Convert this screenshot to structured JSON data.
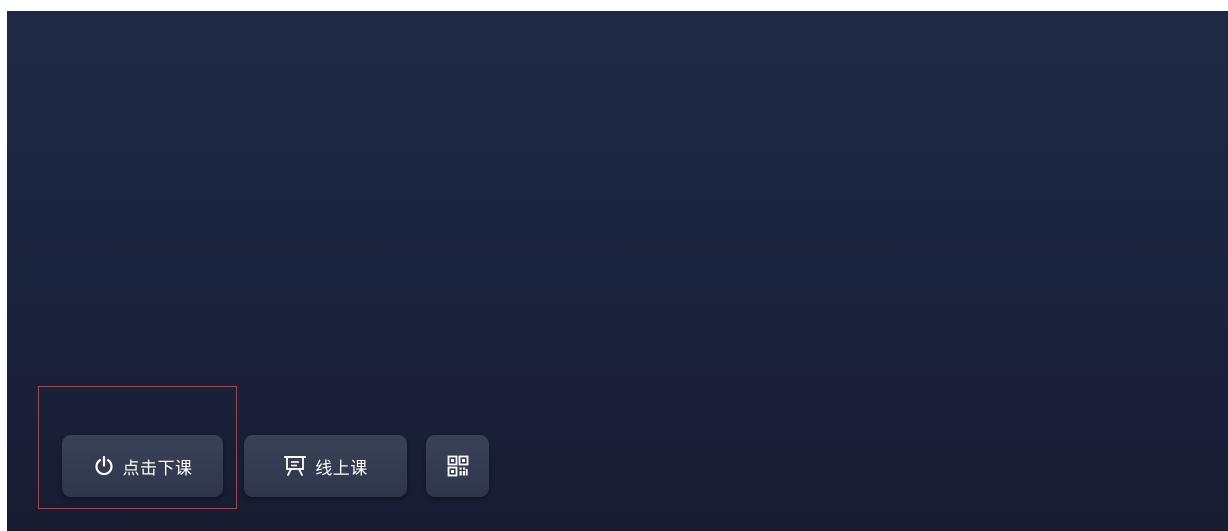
{
  "toolbar": {
    "end_class_label": "点击下课",
    "end_class_icon": "power-icon",
    "online_class_label": "线上课",
    "online_class_icon": "presentation-board-icon",
    "qr_icon": "qr-code-icon"
  },
  "colors": {
    "background_top": "#1e2a45",
    "background_bottom": "#171c31",
    "button": "#353c52",
    "button_text": "#ffffff",
    "highlight_border": "#d03232"
  }
}
